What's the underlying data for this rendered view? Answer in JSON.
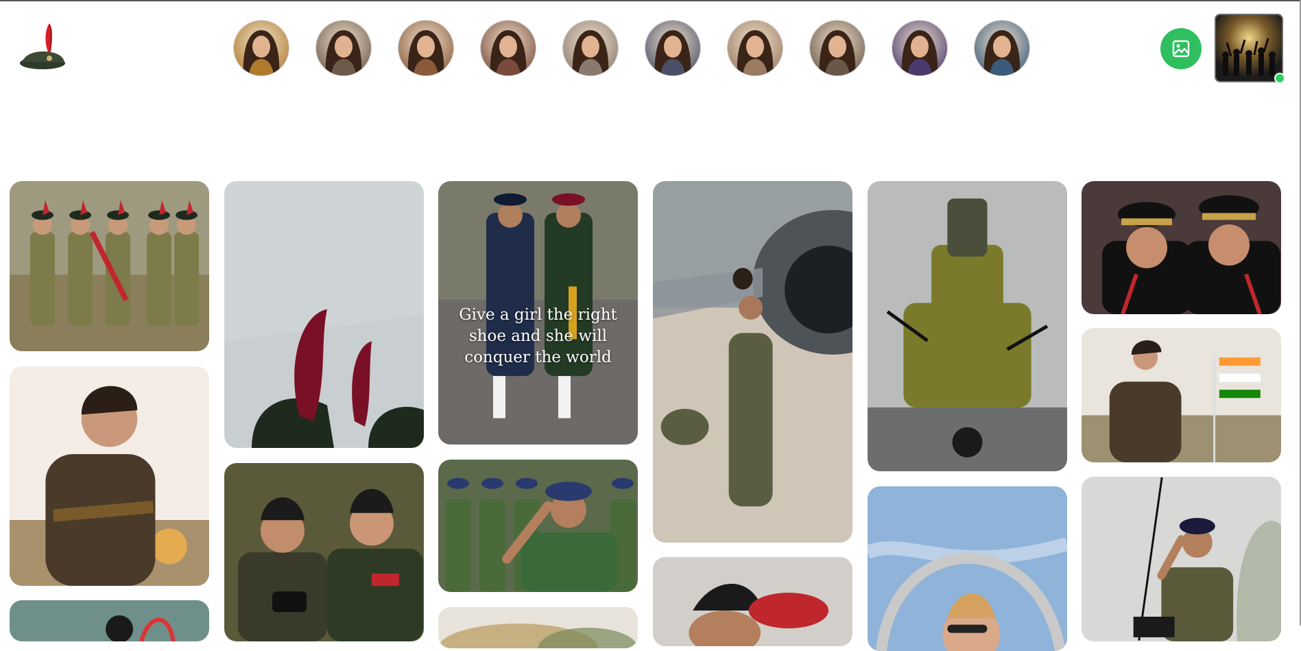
{
  "header": {
    "logo_icon": "beret-icon",
    "stories": [
      {
        "id": "story-1",
        "icon": "portrait-avatar",
        "accent": "#b07a2e"
      },
      {
        "id": "story-2",
        "icon": "portrait-avatar",
        "accent": "#6e5a4a"
      },
      {
        "id": "story-3",
        "icon": "portrait-avatar",
        "accent": "#8a5a3a"
      },
      {
        "id": "story-4",
        "icon": "portrait-avatar",
        "accent": "#7a4a3a"
      },
      {
        "id": "story-5",
        "icon": "portrait-avatar",
        "accent": "#8a7a6e"
      },
      {
        "id": "story-6",
        "icon": "portrait-avatar",
        "accent": "#4a4f66"
      },
      {
        "id": "story-7",
        "icon": "portrait-avatar",
        "accent": "#9a7a60"
      },
      {
        "id": "story-8",
        "icon": "portrait-avatar",
        "accent": "#6b5748"
      },
      {
        "id": "story-9",
        "icon": "portrait-avatar",
        "accent": "#4b3a6e"
      },
      {
        "id": "story-10",
        "icon": "portrait-avatar",
        "accent": "#3a5a7a"
      }
    ],
    "upload_icon": "image-upload-icon",
    "profile": {
      "icon": "party-thumbnail",
      "status": "online"
    }
  },
  "feed": {
    "quote_text": "Give a girl the right shoe and she will conquer the world",
    "tiles": [
      {
        "id": "ncc-cadets-march",
        "palette": [
          "#7e7b4a",
          "#5a5a3a",
          "#c0272d"
        ]
      },
      {
        "id": "red-plume-caps",
        "palette": [
          "#c9ced0",
          "#7a1026",
          "#1f2a1e"
        ]
      },
      {
        "id": "parade-officers-quote",
        "palette": [
          "#6e6a68",
          "#1f2d4a",
          "#233a25"
        ]
      },
      {
        "id": "pilot-by-jet",
        "palette": [
          "#cfc6b8",
          "#5b5d42",
          "#6b7f8d"
        ]
      },
      {
        "id": "bike-stunt-pyramid",
        "palette": [
          "#b9bcbb",
          "#7a7a2a",
          "#4b4e3a"
        ]
      },
      {
        "id": "officers-smiling",
        "palette": [
          "#d4d2cf",
          "#111111",
          "#c9a24a"
        ]
      },
      {
        "id": "soldier-portrait-sunset",
        "palette": [
          "#f3ede6",
          "#4a3a2a",
          "#7a5a2a"
        ]
      },
      {
        "id": "cadets-laughing",
        "palette": [
          "#5a5a3a",
          "#1b1b1b",
          "#c0272d"
        ]
      },
      {
        "id": "cadet-salute-beret",
        "palette": [
          "#5a6a4a",
          "#2a3a6e",
          "#3a6a3a"
        ]
      },
      {
        "id": "soldier-flag",
        "palette": [
          "#e9e4dc",
          "#4a3a2a",
          "#e58a2a"
        ]
      },
      {
        "id": "pilot-cockpit",
        "palette": [
          "#8fb3d9",
          "#c9c9c9",
          "#d9a98a"
        ]
      },
      {
        "id": "officer-salute-podium",
        "palette": [
          "#d8d8d6",
          "#5a5a3a",
          "#1a1a1a"
        ]
      },
      {
        "id": "partial-bottom-left",
        "palette": [
          "#6f8f8a",
          "#c8cfcf",
          "#d33"
        ]
      },
      {
        "id": "partial-bottom-center",
        "palette": [
          "#e8e4dc",
          "#b89a5a",
          "#7a8a5a"
        ]
      },
      {
        "id": "partial-bottom-mid",
        "palette": [
          "#d2cfcb",
          "#c0272d",
          "#1a1a1a"
        ]
      }
    ]
  }
}
